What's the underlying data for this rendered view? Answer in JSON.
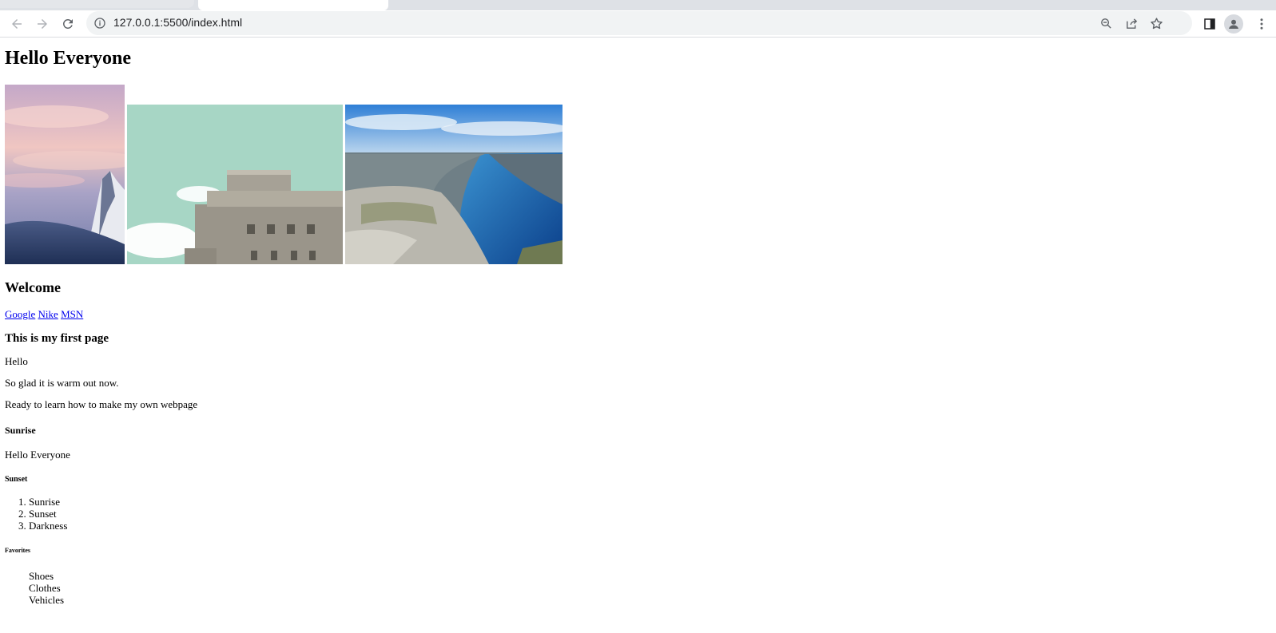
{
  "browser": {
    "url": "127.0.0.1:5500/index.html",
    "icons": [
      "back-icon",
      "forward-icon",
      "reload-icon",
      "info-icon",
      "zoom-out-icon",
      "share-icon",
      "star-icon",
      "side-panel-icon",
      "profile-icon",
      "menu-icon"
    ]
  },
  "page": {
    "heading1": "Hello Everyone",
    "images": [
      "mountain-sunset-photo",
      "concrete-bunker-photo",
      "fjord-cliff-photo"
    ],
    "heading2": "Welcome",
    "links": [
      "Google",
      "Nike",
      "MSN"
    ],
    "heading3": "This is my first page",
    "paragraphs": [
      "Hello",
      "So glad it is warm out now.",
      "Ready to learn how to make my own webpage"
    ],
    "heading4": "Sunrise",
    "paragraph4": "Hello Everyone",
    "heading5": "Sunset",
    "ordered_list": [
      "Sunrise",
      "Sunset",
      "Darkness"
    ],
    "heading6": "Favorites",
    "unordered_list": [
      "Shoes",
      "Clothes",
      "Vehicles"
    ]
  },
  "colors": {
    "link": "#0000ee",
    "chrome_bg": "#dee1e6",
    "omnibox_bg": "#f1f3f4"
  }
}
